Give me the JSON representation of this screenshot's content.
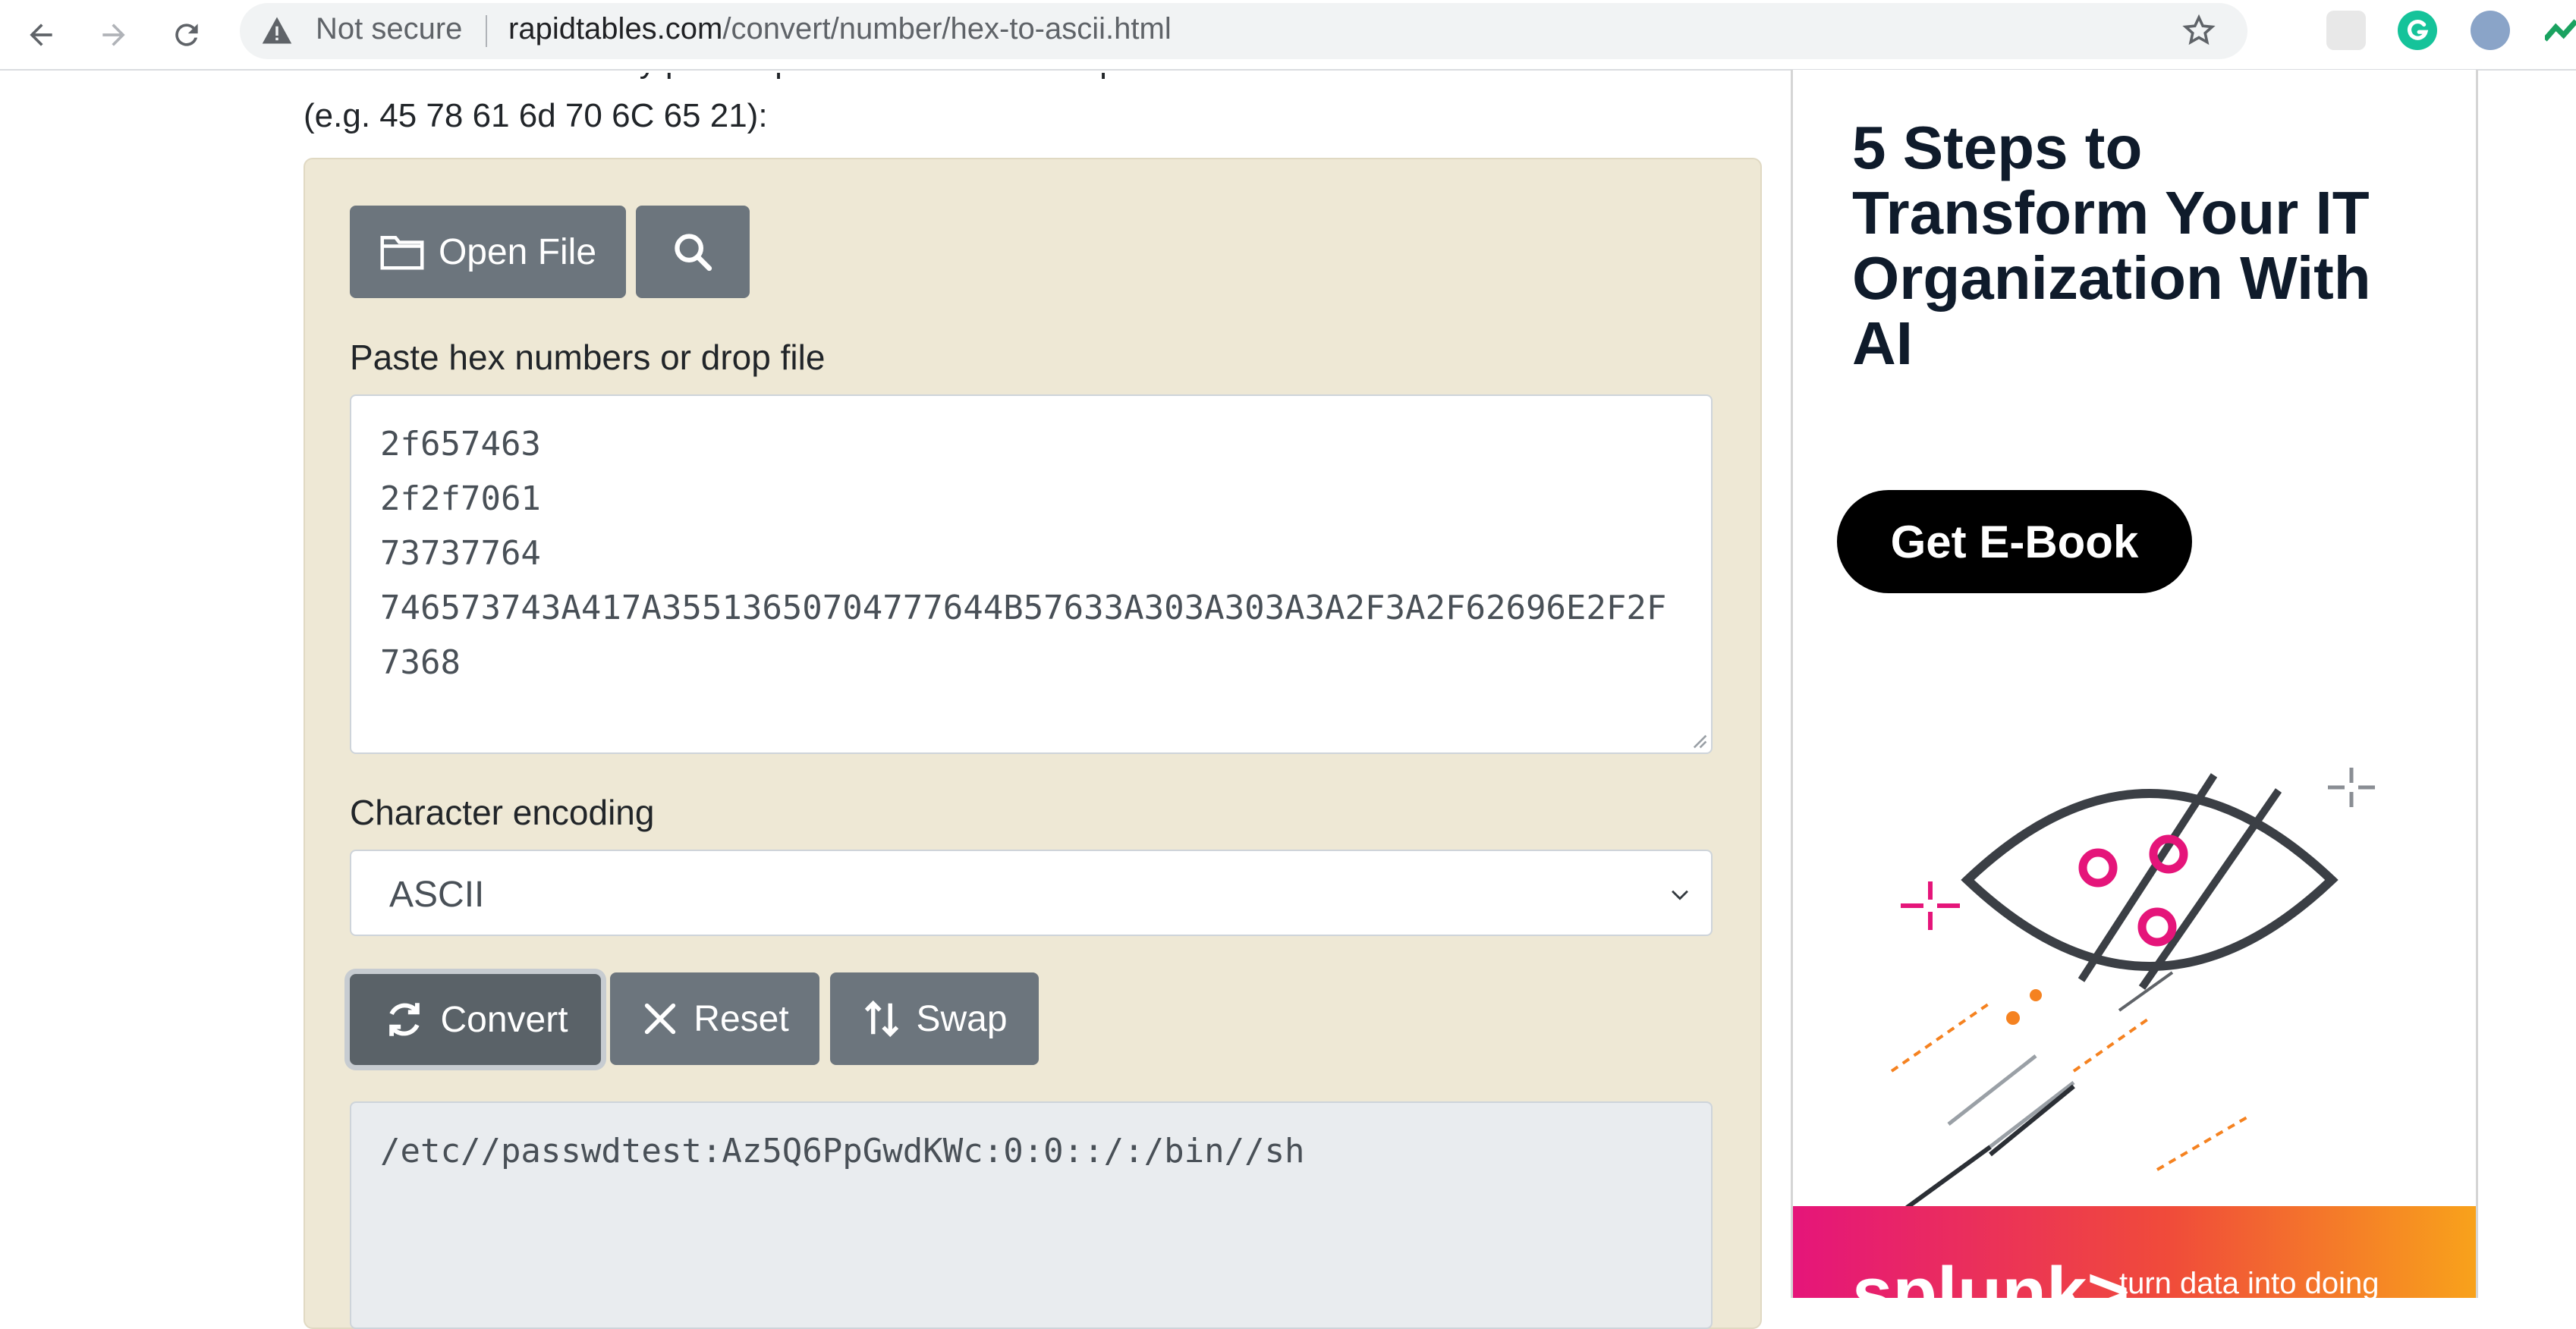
{
  "browser": {
    "security_label": "Not secure",
    "url_host": "rapidtables.com",
    "url_path": "/convert/number/hex-to-ascii.html"
  },
  "page": {
    "intro_cut_text": "...hex numbers with any prefix / postfix / delimiter and press the Convert button",
    "intro_example": "(e.g. 45 78 61 6d 70 6C 65 21):",
    "open_file_label": "Open File",
    "input_label": "Paste hex numbers or drop file",
    "input_lines": [
      "2f657463",
      "2f2f7061",
      "73737764",
      "746573743A417A3551365070477764 4B57633A303A303A3A2F3A2F62696E2F2F7368"
    ],
    "input_value": "2f657463\n2f2f7061\n73737764\n746573743A417A35513650704777644B57633A303A303A3A2F3A2F62696E2F2F7368",
    "encoding_label": "Character encoding",
    "encoding_selected": "ASCII",
    "convert_label": "Convert",
    "reset_label": "Reset",
    "swap_label": "Swap",
    "output_value": "/etc//passwdtest:Az5Q6PpGwdKWc:0:0::/:/bin//sh"
  },
  "ad": {
    "title": "5 Steps to Transform Your IT Organization With AI",
    "cta_label": "Get E-Book",
    "brand": "splunk>",
    "tagline": "turn data into doing"
  },
  "colors": {
    "panel_bg": "#eee8d5",
    "button_bg": "#6c757d",
    "accent_pink": "#e5157a",
    "accent_orange": "#f58220"
  },
  "icons": [
    "back-arrow-icon",
    "forward-arrow-icon",
    "reload-icon",
    "warning-icon",
    "star-icon",
    "folder-icon",
    "search-icon",
    "refresh-icon",
    "close-icon",
    "swap-icon",
    "chevron-down-icon"
  ]
}
